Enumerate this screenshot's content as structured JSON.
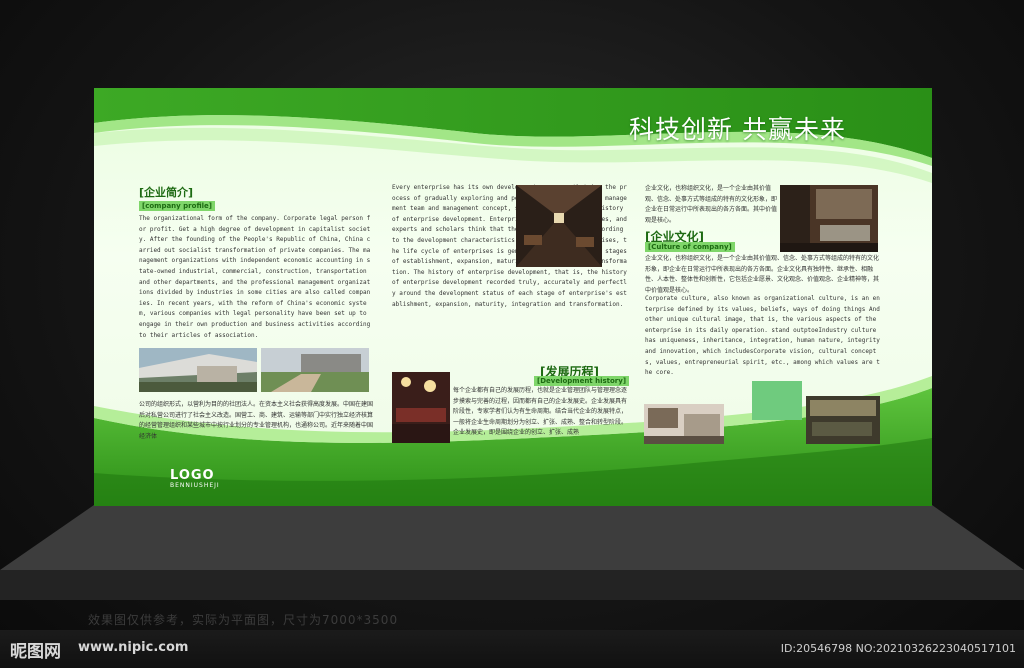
{
  "board": {
    "slogan": "科技创新 共赢未来",
    "logo": {
      "main": "LOGO",
      "sub": "BENNIUSHEJI"
    }
  },
  "profile": {
    "title": "[企业简介]",
    "subtitle": "[company profile]",
    "english": "The organizational form of the company. Corporate legal person for profit. Get a high degree of development in capitalist society. After the founding of the People's Republic of China, China carried out socialist transformation of private companies. The management organizations with independent economic accounting in state-owned industrial, commercial, construction, transportation and other departments, and the professional management organizations divided by industries in some cities are also called companies. In recent years, with the reform of China's economic system, various companies with legal personality have been set up to engage in their own production and business activities according to their articles of association.",
    "chinese": "公司的组织形式，以营利为目的的社团法人。在资本主义社会获得高度发展。中国在建国后对私营公司进行了社会主义改造。国营工、商、建筑、运输等部门中实行独立经济核算的经营管理组织和某些城市中按行业划分的专业管理机构，也通称公司。近年来随着中国经济体"
  },
  "middle": {
    "english_top": "Every enterprise has its own development process, that is, the process of gradually exploring and perfecting the enterprise management team and management concept, so that it has its own history of enterprise development. Enterprise development has stages, and experts and scholars think that there is a life cycle. According to the development characteristics of contemporary enterprises, the life cycle of enterprises is generally divided into the stages of establishment, expansion, maturity, integration and transformation. The history of enterprise development, that is, the history of enterprise development recorded truly, accurately and perfectly around the development status of each stage of enterprise's establishment, expansion, maturity, integration and transformation.",
    "history_title": "[发展历程]",
    "history_subtitle": "[Development history]",
    "history_chinese": "每个企业都有自己的发展历程，也就是企业管理团队与管理理念逐步摸索与完善的过程，因而都有自己的企业发展史。企业发展具有阶段性，专家学者们认为有生命周期。结合当代企业的发展特点，一般将企业生命周期划分为创立、扩张、成熟、整合和转型阶段。企业发展史，即是围绕企业的创立、扩张、成熟"
  },
  "culture": {
    "chinese_top": "企业文化，也称组织文化，是一个企业由其价值观、信念、处事方式等组成的特有的文化形象，即企业在日常运行中所表现出的各方各面。其中价值观是核心。",
    "title": "[企业文化]",
    "subtitle": "[Culture of company]",
    "chinese_mid": "企业文化，也称组织文化，是一个企业由其价值观、信念、处事方式等组成的特有的文化形象，即企业在日常运行中所表现出的各方各面。企业文化具有独特性、继承性、相融性、人本性、整体性和创新性，它包括企业愿景、文化观念、价值观念、企业精神等，其中价值观是核心。",
    "english": "Corporate culture, also known as organizational culture, is an enterprise defined by its values, beliefs, ways of doing things And other unique cultural image, that is, the various aspects of the enterprise in its daily operation. stand outptoeIndustry culture has uniqueness, inheritance, integration, human nature, integrity and innovation, which includesCorporate vision, cultural concepts, values, entrepreneurial spirit, etc., among which values are the core."
  },
  "footer": {
    "caption": "效果图仅供参考，实际为平面图，尺寸为7000*3500",
    "watermark_brand": "昵图网",
    "watermark_url": "www.nipic.com",
    "id_text": "ID:20546798 NO:20210326223040517101"
  }
}
